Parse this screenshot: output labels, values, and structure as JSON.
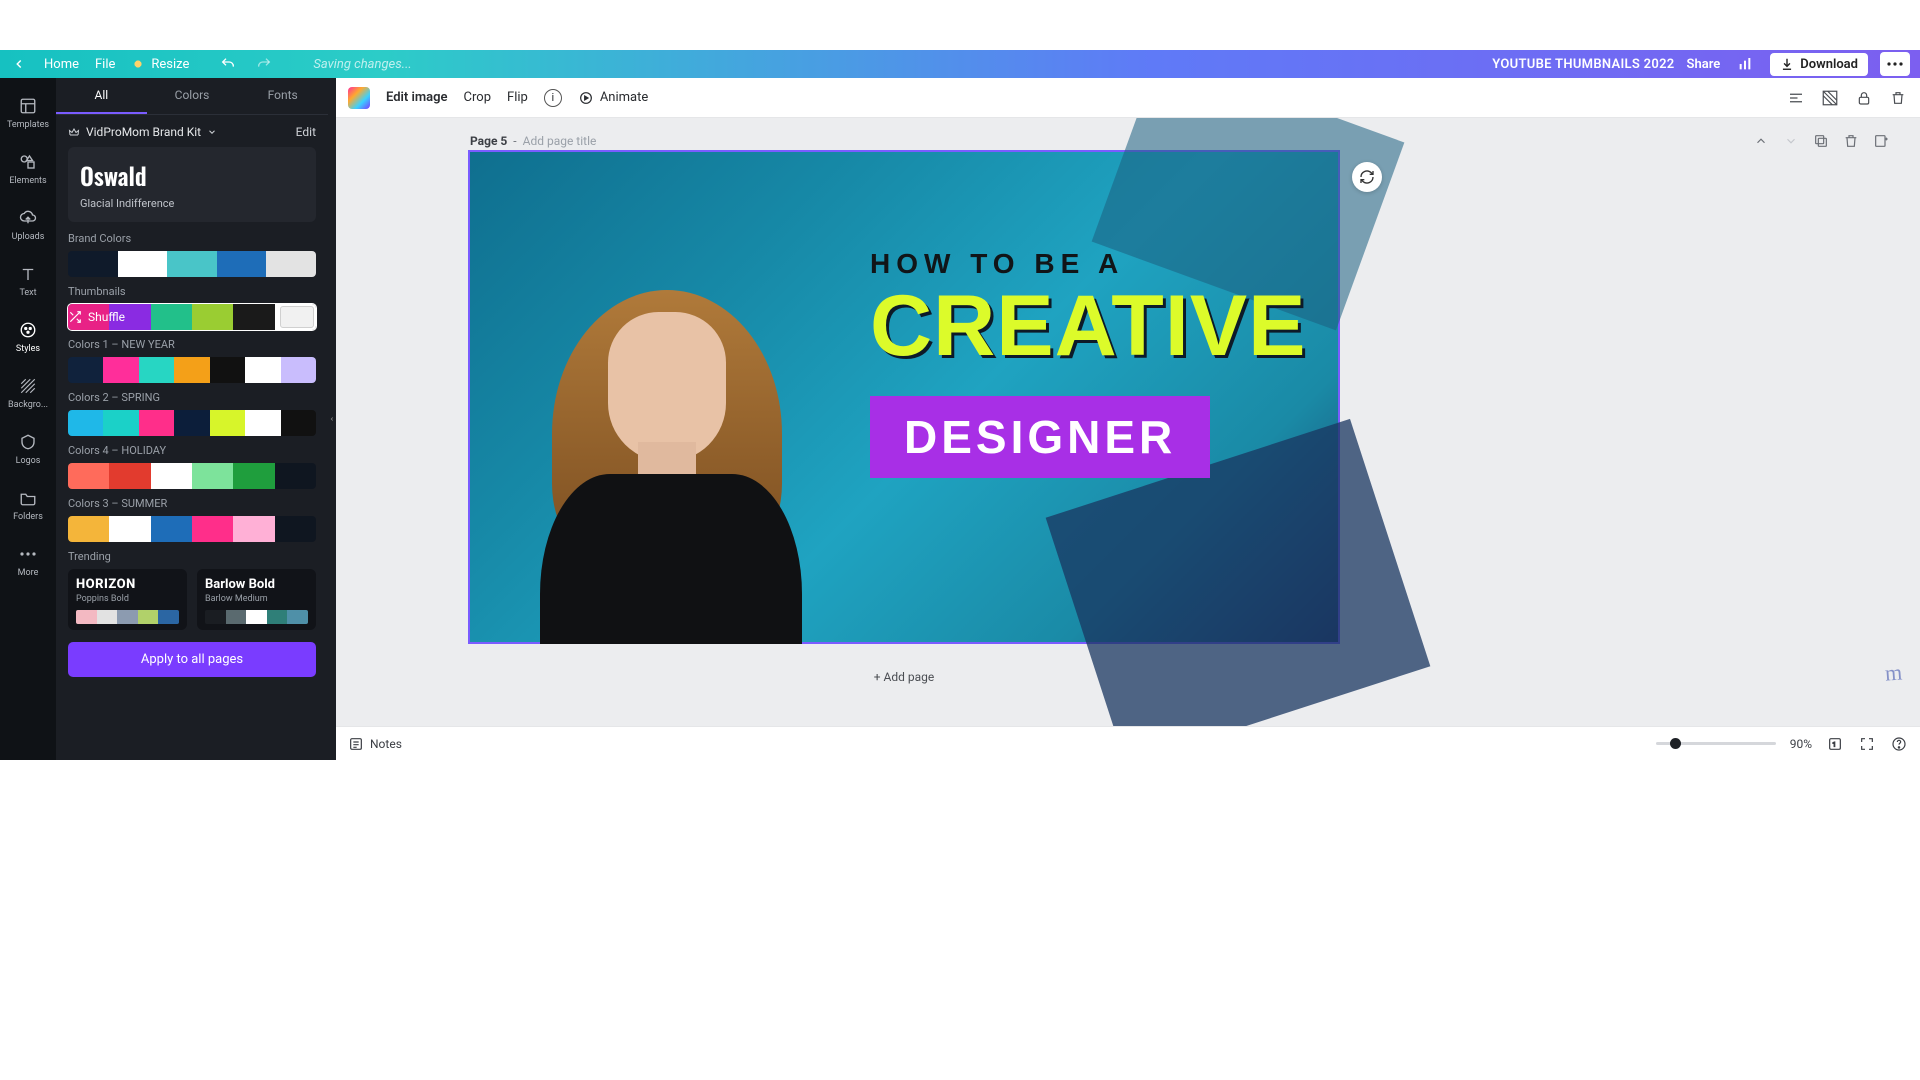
{
  "topbar": {
    "home": "Home",
    "file": "File",
    "resize": "Resize",
    "saving": "Saving changes...",
    "doc_title": "YOUTUBE THUMBNAILS 2022",
    "share": "Share",
    "download": "Download"
  },
  "rail": [
    {
      "key": "templates",
      "label": "Templates"
    },
    {
      "key": "elements",
      "label": "Elements"
    },
    {
      "key": "uploads",
      "label": "Uploads"
    },
    {
      "key": "text",
      "label": "Text"
    },
    {
      "key": "styles",
      "label": "Styles"
    },
    {
      "key": "background",
      "label": "Backgro..."
    },
    {
      "key": "logos",
      "label": "Logos"
    },
    {
      "key": "folders",
      "label": "Folders"
    },
    {
      "key": "more",
      "label": "More"
    }
  ],
  "panel": {
    "tabs": {
      "all": "All",
      "colors": "Colors",
      "fonts": "Fonts",
      "active": "all"
    },
    "brand_kit_name": "VidProMom Brand Kit",
    "edit": "Edit",
    "font_primary": "Oswald",
    "font_secondary": "Glacial Indifference",
    "sections": {
      "brand": {
        "label": "Brand Colors",
        "colors": [
          "#0f1a2a",
          "#ffffff",
          "#49c5c8",
          "#1e6db8",
          "#e3e3e3"
        ]
      },
      "thumbnails": {
        "label": "Thumbnails",
        "colors": [
          "#e82286",
          "#8a2be2",
          "#22c08a",
          "#9acd32",
          "#1a1a1a",
          "#ffffff"
        ],
        "shuffle": "Shuffle"
      },
      "newyear": {
        "label": "Colors 1 – NEW YEAR",
        "colors": [
          "#10223c",
          "#ff2e9a",
          "#27d6c3",
          "#f4a018",
          "#111111",
          "#ffffff",
          "#c9bdfd"
        ]
      },
      "spring": {
        "label": "Colors 2 – SPRING",
        "colors": [
          "#1fb8e8",
          "#1bd1c8",
          "#ff2e8a",
          "#0c1e3a",
          "#d7f52a",
          "#ffffff",
          "#111111"
        ]
      },
      "holiday": {
        "label": "Colors 4 – HOLIDAY",
        "colors": [
          "#ff6b5b",
          "#e23b2e",
          "#ffffff",
          "#7de39b",
          "#1f9e3d",
          "#0f1620"
        ]
      },
      "summer": {
        "label": "Colors 3 – SUMMER",
        "colors": [
          "#f4b53a",
          "#ffffff",
          "#1e6db8",
          "#ff2e8a",
          "#ffb0d6",
          "#0f1620"
        ]
      }
    },
    "trending_label": "Trending",
    "trending": [
      {
        "title": "HORIZON",
        "sub": "Poppins Bold",
        "colors": [
          "#f3b9c2",
          "#e2e2e2",
          "#8c9bb0",
          "#b1d16a",
          "#2b66a3"
        ]
      },
      {
        "title": "Barlow Bold",
        "sub": "Barlow Medium",
        "colors": [
          "#1a1d22",
          "#5a6a6f",
          "#ffffff",
          "#2f7f78",
          "#4f90a8"
        ]
      }
    ],
    "apply": "Apply to all pages"
  },
  "context": {
    "edit_image": "Edit image",
    "crop": "Crop",
    "flip": "Flip",
    "animate": "Animate"
  },
  "page": {
    "label": "Page 5",
    "title_placeholder": "Add page title",
    "line1": "HOW TO BE A",
    "line2": "CREATIVE",
    "designer": "DESIGNER",
    "add_page": "+ Add page"
  },
  "footer": {
    "notes": "Notes",
    "zoom": "90%"
  }
}
